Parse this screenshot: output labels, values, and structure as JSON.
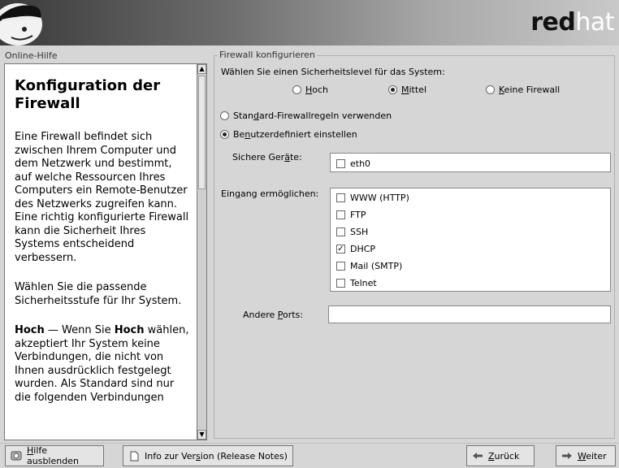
{
  "header": {
    "brand_bold": "red",
    "brand_light": "hat"
  },
  "help": {
    "section_title": "Online-Hilfe",
    "heading": "Konfiguration der Firewall",
    "p1": "Eine Firewall befindet sich zwischen Ihrem Computer und dem Netzwerk und bestimmt, auf welche Ressourcen Ihres Computers ein Remote-Benutzer des Netzwerks zugreifen kann. Eine richtig konfigurierte Firewall kann die Sicherheit Ihres Systems entscheidend verbessern.",
    "p2": "Wählen Sie die passende Sicherheitsstufe für Ihr System.",
    "p3_bold1": "Hoch",
    "p3_part1": " — Wenn Sie ",
    "p3_bold2": "Hoch",
    "p3_part2": " wählen, akzeptiert Ihr System keine Verbindungen, die nicht von Ihnen ausdrücklich festgelegt wurden. Als Standard sind nur die folgenden Verbindungen"
  },
  "firewall": {
    "frame_title": "Firewall konfigurieren",
    "prompt": "Wählen Sie einen Sicherheitslevel für das System:",
    "levels": [
      {
        "label": "Hoch",
        "selected": false
      },
      {
        "label": "Mittel",
        "selected": true
      },
      {
        "label": "Keine Firewall",
        "selected": false
      }
    ],
    "mode_standard": "Standard-Firewallregeln verwenden",
    "mode_custom": "Benutzerdefiniert einstellen",
    "trusted_label": "Sichere Geräte:",
    "trusted_devices": [
      {
        "label": "eth0",
        "checked": false
      }
    ],
    "incoming_label": "Eingang ermöglichen:",
    "services": [
      {
        "label": "WWW (HTTP)",
        "checked": false
      },
      {
        "label": "FTP",
        "checked": false
      },
      {
        "label": "SSH",
        "checked": false
      },
      {
        "label": "DHCP",
        "checked": true
      },
      {
        "label": "Mail (SMTP)",
        "checked": false
      },
      {
        "label": "Telnet",
        "checked": false
      }
    ],
    "other_ports_label": "Andere Ports:",
    "other_ports_value": ""
  },
  "footer": {
    "hide_help": "Hilfe ausblenden",
    "release_notes": "Info zur Version (Release Notes)",
    "back": "Zurück",
    "next": "Weiter"
  }
}
